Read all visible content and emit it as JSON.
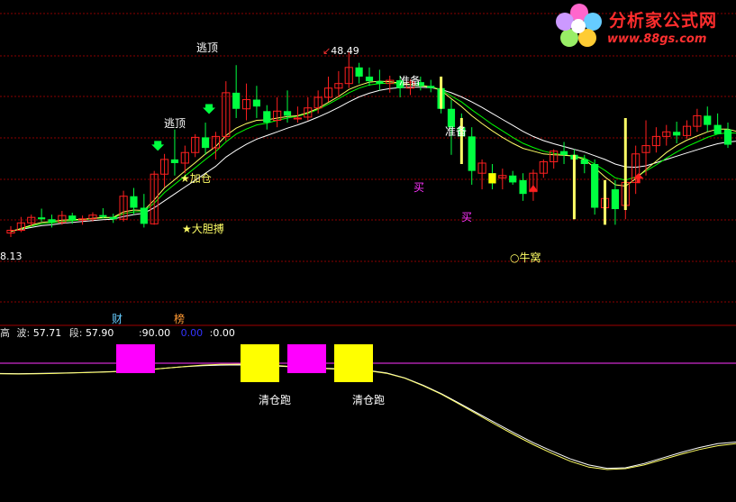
{
  "logo": {
    "title": "分析家公式网",
    "url": "www.88gs.com"
  },
  "annotations": {
    "top_high": "48.49",
    "low_price": "8.13",
    "escape_top_1": "逃顶",
    "escape_top_2": "逃顶",
    "add_position": "★加仓",
    "bold_fight": "★大胆搏",
    "prepare_1": "准备",
    "prepare_2": "准备",
    "buy_1": "买",
    "buy_2": "买",
    "bull_nest": "○牛窝",
    "clear_run_1": "清仓跑",
    "clear_run_2": "清仓跑",
    "cai_tag": "财",
    "bang_tag": "榜"
  },
  "indicator_header": {
    "high_label": "高",
    "wave_label": "波:",
    "wave_value": "57.71",
    "segment_label": "段:",
    "segment_value": "57.90",
    "level_label": ":",
    "level_value": "90.00",
    "blue_value": "0.00",
    "last_label": ":",
    "last_value": "0.00"
  },
  "colors": {
    "up": "#ff2020",
    "down": "#00ff40",
    "ma_white": "#ffffff",
    "ma_green": "#00ff00",
    "ma_yellow": "#ffff66",
    "grid": "#8b0000",
    "magenta_block": "#ff00ff",
    "yellow_block": "#ffff00"
  },
  "chart_data": [
    {
      "type": "candlestick",
      "title": "",
      "xlabel": "",
      "ylabel": "",
      "ylim": [
        8.13,
        48.49
      ],
      "grid": true,
      "candles": [
        {
          "o": 9.0,
          "h": 10.5,
          "l": 8.13,
          "c": 9.6
        },
        {
          "o": 9.6,
          "h": 12.5,
          "l": 9.2,
          "c": 11.2
        },
        {
          "o": 11.2,
          "h": 13.0,
          "l": 10.5,
          "c": 12.4
        },
        {
          "o": 12.4,
          "h": 14.3,
          "l": 11.5,
          "c": 12.0
        },
        {
          "o": 12.0,
          "h": 13.0,
          "l": 10.2,
          "c": 11.3
        },
        {
          "o": 11.3,
          "h": 13.8,
          "l": 10.8,
          "c": 12.8
        },
        {
          "o": 12.8,
          "h": 13.4,
          "l": 11.0,
          "c": 11.8
        },
        {
          "o": 11.8,
          "h": 12.8,
          "l": 10.8,
          "c": 12.1
        },
        {
          "o": 12.1,
          "h": 13.5,
          "l": 11.5,
          "c": 12.9
        },
        {
          "o": 12.9,
          "h": 14.4,
          "l": 12.2,
          "c": 12.5
        },
        {
          "o": 12.5,
          "h": 13.2,
          "l": 11.2,
          "c": 12.0
        },
        {
          "o": 12.0,
          "h": 18.2,
          "l": 11.5,
          "c": 17.0
        },
        {
          "o": 17.0,
          "h": 18.8,
          "l": 13.0,
          "c": 14.5
        },
        {
          "o": 14.5,
          "h": 17.5,
          "l": 10.2,
          "c": 11.0
        },
        {
          "o": 11.0,
          "h": 22.5,
          "l": 10.8,
          "c": 21.8
        },
        {
          "o": 21.8,
          "h": 26.2,
          "l": 19.0,
          "c": 25.0
        },
        {
          "o": 25.0,
          "h": 31.5,
          "l": 21.5,
          "c": 24.2
        },
        {
          "o": 24.2,
          "h": 28.0,
          "l": 22.0,
          "c": 26.5
        },
        {
          "o": 26.5,
          "h": 30.5,
          "l": 25.5,
          "c": 29.8
        },
        {
          "o": 29.8,
          "h": 33.0,
          "l": 26.0,
          "c": 27.5
        },
        {
          "o": 27.5,
          "h": 31.0,
          "l": 25.0,
          "c": 30.0
        },
        {
          "o": 30.0,
          "h": 42.0,
          "l": 29.0,
          "c": 39.5
        },
        {
          "o": 39.5,
          "h": 45.5,
          "l": 34.0,
          "c": 36.0
        },
        {
          "o": 36.0,
          "h": 41.5,
          "l": 33.5,
          "c": 38.0
        },
        {
          "o": 38.0,
          "h": 41.0,
          "l": 34.0,
          "c": 36.5
        },
        {
          "o": 35.5,
          "h": 36.8,
          "l": 31.5,
          "c": 33.0
        },
        {
          "o": 33.5,
          "h": 38.5,
          "l": 32.0,
          "c": 35.5
        },
        {
          "o": 35.5,
          "h": 40.0,
          "l": 33.0,
          "c": 34.5
        },
        {
          "o": 34.0,
          "h": 36.5,
          "l": 33.0,
          "c": 34.0
        },
        {
          "o": 34.2,
          "h": 38.5,
          "l": 33.5,
          "c": 36.2
        },
        {
          "o": 36.2,
          "h": 40.0,
          "l": 35.0,
          "c": 38.5
        },
        {
          "o": 38.5,
          "h": 43.0,
          "l": 37.5,
          "c": 40.5
        },
        {
          "o": 40.5,
          "h": 44.2,
          "l": 38.5,
          "c": 41.5
        },
        {
          "o": 41.5,
          "h": 48.49,
          "l": 40.5,
          "c": 45.0
        },
        {
          "o": 45.0,
          "h": 46.0,
          "l": 41.5,
          "c": 43.0
        },
        {
          "o": 43.0,
          "h": 45.0,
          "l": 41.0,
          "c": 42.0
        },
        {
          "o": 42.0,
          "h": 44.5,
          "l": 40.0,
          "c": 41.5
        },
        {
          "o": 41.5,
          "h": 43.2,
          "l": 39.5,
          "c": 42.2
        },
        {
          "o": 42.2,
          "h": 43.2,
          "l": 38.5,
          "c": 40.5
        },
        {
          "o": 40.5,
          "h": 42.4,
          "l": 39.0,
          "c": 41.8
        },
        {
          "o": 41.8,
          "h": 43.0,
          "l": 40.0,
          "c": 41.0
        },
        {
          "o": 41.0,
          "h": 42.3,
          "l": 39.6,
          "c": 40.5
        },
        {
          "o": 40.5,
          "h": 41.2,
          "l": 35.0,
          "c": 36.0
        },
        {
          "o": 36.0,
          "h": 38.0,
          "l": 26.0,
          "c": 32.0
        },
        {
          "o": 32.0,
          "h": 35.0,
          "l": 27.0,
          "c": 30.0
        },
        {
          "o": 30.0,
          "h": 32.0,
          "l": 19.5,
          "c": 22.5
        },
        {
          "o": 22.0,
          "h": 25.0,
          "l": 18.5,
          "c": 24.2
        },
        {
          "o": 22.0,
          "h": 24.0,
          "l": 18.5,
          "c": 19.8
        },
        {
          "o": 21.0,
          "h": 23.0,
          "l": 18.5,
          "c": 21.5
        },
        {
          "o": 21.5,
          "h": 22.5,
          "l": 19.5,
          "c": 20.0
        },
        {
          "o": 20.5,
          "h": 22.0,
          "l": 16.0,
          "c": 17.5
        },
        {
          "o": 18.0,
          "h": 22.8,
          "l": 16.0,
          "c": 22.0
        },
        {
          "o": 22.0,
          "h": 25.0,
          "l": 21.0,
          "c": 24.5
        },
        {
          "o": 24.5,
          "h": 27.2,
          "l": 23.0,
          "c": 26.8
        },
        {
          "o": 26.8,
          "h": 28.8,
          "l": 24.0,
          "c": 26.0
        },
        {
          "o": 26.0,
          "h": 27.2,
          "l": 24.2,
          "c": 25.0
        },
        {
          "o": 25.0,
          "h": 26.0,
          "l": 22.0,
          "c": 24.0
        },
        {
          "o": 24.0,
          "h": 25.0,
          "l": 13.0,
          "c": 14.5
        },
        {
          "o": 14.5,
          "h": 19.0,
          "l": 12.5,
          "c": 16.5
        },
        {
          "o": 18.5,
          "h": 20.5,
          "l": 10.8,
          "c": 14.2
        },
        {
          "o": 15.0,
          "h": 21.0,
          "l": 12.0,
          "c": 20.0
        },
        {
          "o": 20.0,
          "h": 28.0,
          "l": 17.5,
          "c": 26.2
        },
        {
          "o": 26.5,
          "h": 33.5,
          "l": 21.5,
          "c": 28.0
        },
        {
          "o": 28.0,
          "h": 32.0,
          "l": 26.5,
          "c": 30.0
        },
        {
          "o": 30.0,
          "h": 32.5,
          "l": 28.0,
          "c": 31.0
        },
        {
          "o": 31.0,
          "h": 33.2,
          "l": 28.5,
          "c": 30.2
        },
        {
          "o": 30.2,
          "h": 33.5,
          "l": 29.5,
          "c": 32.2
        },
        {
          "o": 32.2,
          "h": 36.0,
          "l": 31.0,
          "c": 34.5
        },
        {
          "o": 34.5,
          "h": 36.5,
          "l": 31.0,
          "c": 32.5
        },
        {
          "o": 32.5,
          "h": 35.0,
          "l": 31.0,
          "c": 30.5
        },
        {
          "o": 31.5,
          "h": 33.0,
          "l": 27.5,
          "c": 28.2
        }
      ],
      "ma_series": [
        {
          "color": "white",
          "values": [
            9.5,
            9.8,
            10.2,
            10.6,
            10.8,
            11.1,
            11.3,
            11.5,
            11.7,
            11.9,
            12.0,
            12.6,
            13.0,
            13.3,
            14.5,
            16.0,
            17.5,
            19.0,
            20.5,
            22.0,
            23.5,
            25.5,
            27.0,
            28.3,
            29.4,
            30.2,
            31.0,
            31.8,
            32.5,
            33.3,
            34.2,
            35.2,
            36.3,
            37.5,
            38.6,
            39.4,
            40.0,
            40.4,
            40.6,
            40.7,
            40.7,
            40.6,
            40.2,
            39.5,
            38.6,
            37.5,
            36.3,
            35.0,
            33.7,
            32.4,
            31.1,
            30.0,
            29.1,
            28.4,
            27.8,
            27.2,
            26.6,
            25.8,
            25.0,
            24.0,
            23.4,
            23.3,
            23.6,
            24.3,
            25.0,
            25.7,
            26.4,
            27.1,
            27.8,
            28.4,
            28.8,
            29.0
          ]
        },
        {
          "color": "green",
          "values": [
            9.4,
            9.9,
            10.5,
            11.0,
            11.2,
            11.5,
            11.7,
            11.9,
            12.1,
            12.3,
            12.3,
            13.2,
            13.6,
            13.7,
            15.5,
            17.8,
            19.6,
            21.4,
            23.2,
            25.0,
            26.7,
            28.8,
            30.5,
            31.6,
            32.5,
            32.9,
            33.5,
            34.0,
            34.4,
            35.0,
            35.9,
            37.0,
            38.2,
            39.5,
            40.5,
            41.2,
            41.5,
            41.6,
            41.4,
            41.2,
            41.0,
            40.8,
            40.2,
            38.8,
            37.5,
            35.8,
            34.2,
            32.6,
            31.2,
            29.8,
            28.5,
            27.6,
            26.8,
            26.3,
            26.0,
            25.7,
            25.3,
            24.0,
            22.6,
            21.0,
            20.5,
            21.2,
            22.5,
            23.8,
            25.3,
            26.6,
            27.8,
            28.8,
            29.8,
            30.5,
            30.8,
            30.7
          ]
        },
        {
          "color": "yellow",
          "values": [
            9.3,
            10.0,
            10.7,
            11.3,
            11.5,
            11.8,
            11.9,
            12.0,
            12.2,
            12.4,
            12.4,
            13.6,
            14.0,
            13.9,
            16.2,
            18.8,
            20.6,
            22.5,
            24.3,
            26.2,
            27.8,
            30.2,
            31.8,
            32.8,
            33.5,
            33.6,
            34.0,
            34.3,
            34.5,
            35.2,
            36.1,
            37.4,
            38.7,
            40.2,
            41.1,
            41.8,
            42.0,
            41.9,
            41.6,
            41.3,
            41.1,
            40.8,
            40.0,
            38.2,
            36.5,
            34.5,
            32.8,
            31.2,
            29.8,
            28.5,
            27.4,
            26.8,
            26.2,
            26.0,
            25.9,
            25.7,
            25.0,
            23.2,
            21.2,
            19.5,
            19.2,
            20.8,
            22.8,
            24.6,
            26.5,
            28.0,
            29.2,
            30.1,
            31.0,
            31.6,
            31.6,
            31.0
          ]
        }
      ]
    },
    {
      "type": "line",
      "title": "",
      "series": [
        {
          "color": "white",
          "values": [
            57.9,
            57.8,
            57.9,
            58.1,
            58.3,
            58.6,
            58.9,
            59.3,
            60.0,
            60.8,
            61.6,
            62.2,
            62.5,
            62.6,
            62.4,
            62.0,
            61.5,
            61.0,
            60.6,
            60.2,
            59.6,
            58.2,
            55.5,
            51.5,
            46.8,
            41.5,
            36.0,
            30.5,
            25.2,
            20.1,
            15.5,
            11.3,
            8.0,
            6.2,
            6.5,
            8.8,
            11.8,
            14.8,
            17.5,
            19.6,
            20.5
          ]
        },
        {
          "color": "yellow",
          "values": [
            57.7,
            57.6,
            57.7,
            57.9,
            58.2,
            58.5,
            58.8,
            59.3,
            60.0,
            60.8,
            61.7,
            62.5,
            62.9,
            63.0,
            62.8,
            62.3,
            61.6,
            60.9,
            60.4,
            60.0,
            59.4,
            58.0,
            55.3,
            51.2,
            46.5,
            41.0,
            35.3,
            29.6,
            24.2,
            19.0,
            14.3,
            10.0,
            6.8,
            5.5,
            6.0,
            8.0,
            10.9,
            13.8,
            16.4,
            18.5,
            19.6
          ]
        }
      ],
      "markers": [
        {
          "label": "magenta",
          "count": 2
        },
        {
          "label": "yellow",
          "count": 2
        }
      ]
    }
  ]
}
